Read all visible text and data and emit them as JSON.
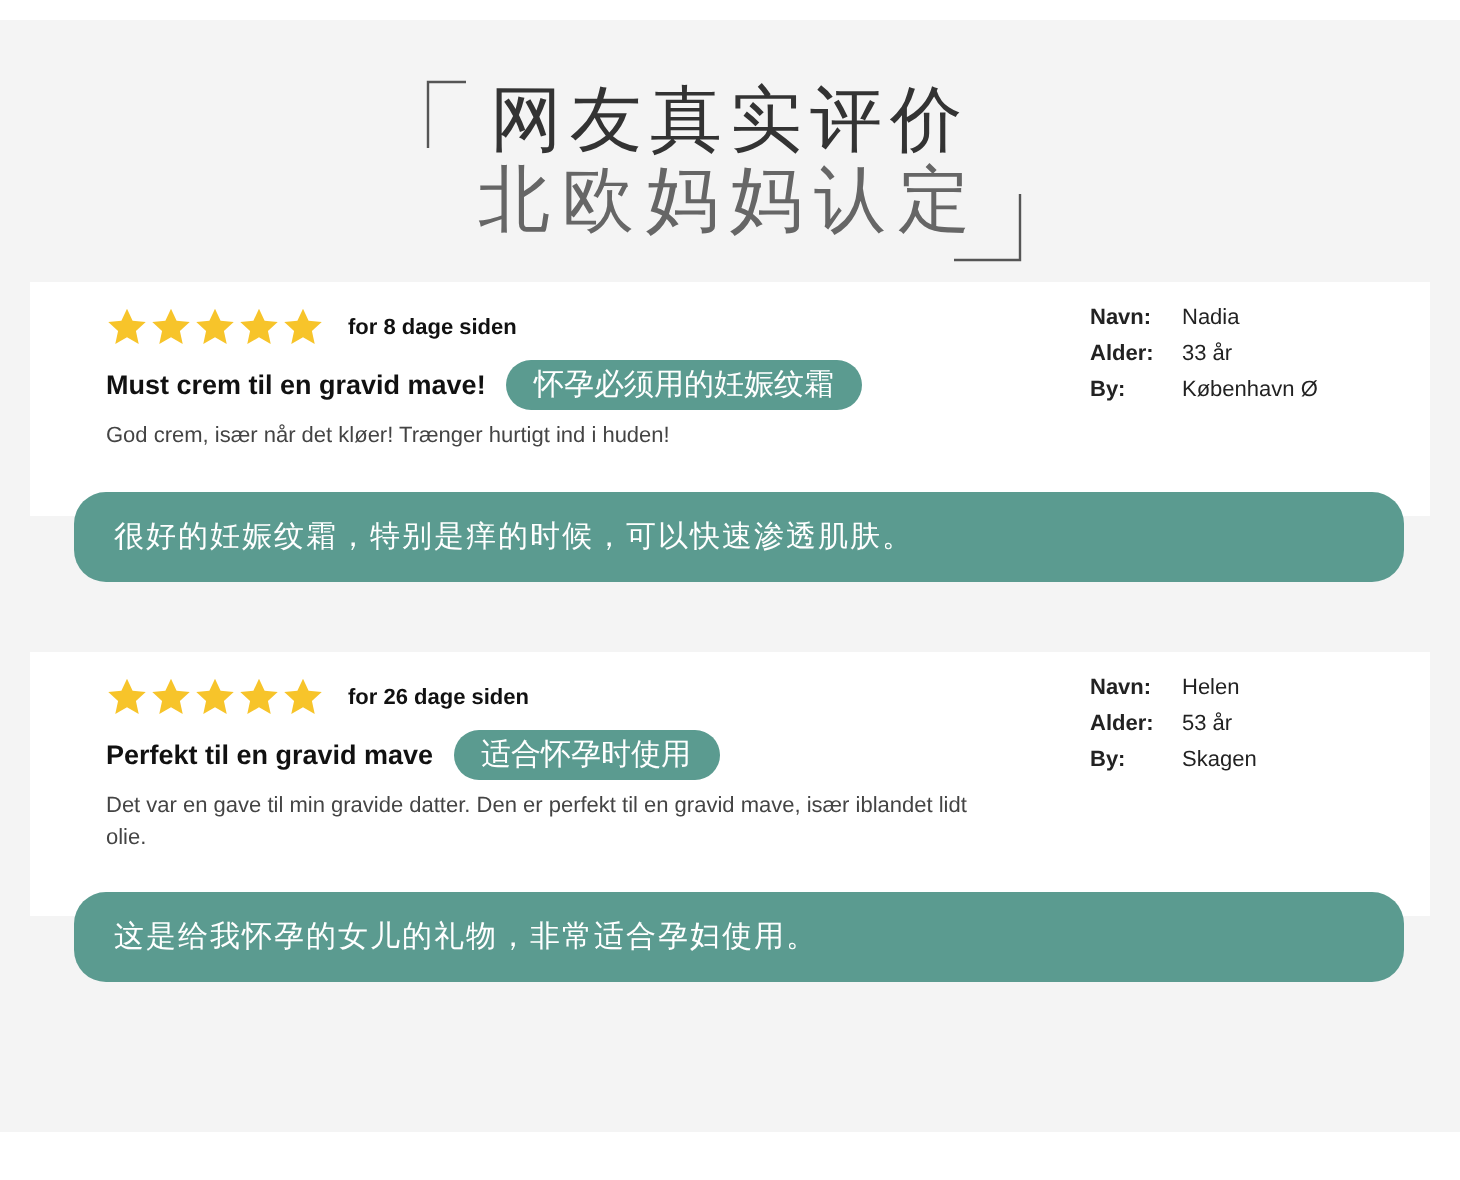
{
  "heading": {
    "line_1": "网友真实评价",
    "line_2": "北欧妈妈认定"
  },
  "reviews": [
    {
      "stars": 5,
      "date": "for 8 dage siden",
      "title": "Must crem til en gravid mave!",
      "tag": "怀孕必须用的妊娠纹霜",
      "body": "God crem, især når det kløer! Trænger hurtigt ind i huden!",
      "details": [
        {
          "label": "Navn:",
          "value": "Nadia"
        },
        {
          "label": "Alder:",
          "value": "33 år"
        },
        {
          "label": "By:",
          "value": "København Ø"
        }
      ],
      "translation": "很好的妊娠纹霜，特别是痒的时候，可以快速渗透肌肤。"
    },
    {
      "stars": 5,
      "date": "for 26 dage siden",
      "title": "Perfekt til en gravid mave",
      "tag": "适合怀孕时使用",
      "body": "Det var en gave til min gravide datter. Den er perfekt til en gravid mave, især iblandet lidt olie.",
      "details": [
        {
          "label": "Navn:",
          "value": "Helen"
        },
        {
          "label": "Alder:",
          "value": "53 år"
        },
        {
          "label": "By:",
          "value": "Skagen"
        }
      ],
      "translation": "这是给我怀孕的女儿的礼物，非常适合孕妇使用。"
    }
  ]
}
